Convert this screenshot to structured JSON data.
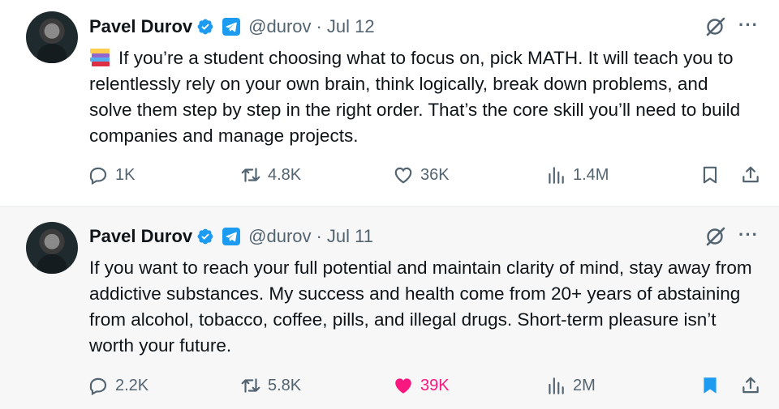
{
  "tweets": [
    {
      "name": "Pavel Durov",
      "handle": "@durov",
      "separator": "·",
      "date": "Jul 12",
      "text": "If you’re a student choosing what to focus on, pick MATH. It will teach you to relentlessly rely on your own brain, think logically, break down problems, and solve them step by step in the right order. That’s the core skill you’ll need to build companies and manage projects.",
      "leading_emoji": "books-emoji",
      "replies": "1K",
      "retweets": "4.8K",
      "likes": "36K",
      "views": "1.4M",
      "liked": false,
      "bookmarked": false
    },
    {
      "name": "Pavel Durov",
      "handle": "@durov",
      "separator": "·",
      "date": "Jul 11",
      "text": "If you want to reach your full potential and maintain clarity of mind, stay away from addictive substances. My success and health come from 20+ years of abstaining from alcohol, tobacco, coffee, pills, and illegal drugs. Short-term pleasure isn’t worth your future.",
      "replies": "2.2K",
      "retweets": "5.8K",
      "likes": "39K",
      "views": "2M",
      "liked": true,
      "bookmarked": true
    }
  ],
  "colors": {
    "verified": "#1d9bf0",
    "liked": "#f91880",
    "bookmark_active": "#1d9bf0",
    "muted": "#536471"
  }
}
